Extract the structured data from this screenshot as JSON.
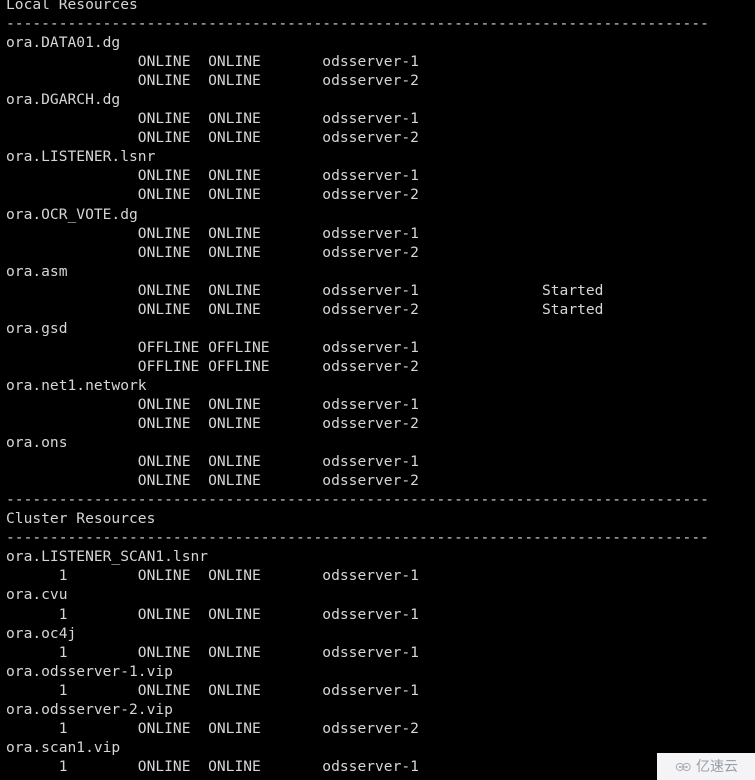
{
  "terminal": {
    "background_color": "#000000",
    "text_color": "#d6d6d6",
    "separator_line": "--------------------------------------------------------------------------------",
    "sections": [
      {
        "title": "Local Resources",
        "resources": [
          {
            "name": "ora.DATA01.dg",
            "instances": [
              {
                "id": "",
                "target": "ONLINE",
                "state": "ONLINE",
                "server": "odsserver-1",
                "details": ""
              },
              {
                "id": "",
                "target": "ONLINE",
                "state": "ONLINE",
                "server": "odsserver-2",
                "details": ""
              }
            ]
          },
          {
            "name": "ora.DGARCH.dg",
            "instances": [
              {
                "id": "",
                "target": "ONLINE",
                "state": "ONLINE",
                "server": "odsserver-1",
                "details": ""
              },
              {
                "id": "",
                "target": "ONLINE",
                "state": "ONLINE",
                "server": "odsserver-2",
                "details": ""
              }
            ]
          },
          {
            "name": "ora.LISTENER.lsnr",
            "instances": [
              {
                "id": "",
                "target": "ONLINE",
                "state": "ONLINE",
                "server": "odsserver-1",
                "details": ""
              },
              {
                "id": "",
                "target": "ONLINE",
                "state": "ONLINE",
                "server": "odsserver-2",
                "details": ""
              }
            ]
          },
          {
            "name": "ora.OCR_VOTE.dg",
            "instances": [
              {
                "id": "",
                "target": "ONLINE",
                "state": "ONLINE",
                "server": "odsserver-1",
                "details": ""
              },
              {
                "id": "",
                "target": "ONLINE",
                "state": "ONLINE",
                "server": "odsserver-2",
                "details": ""
              }
            ]
          },
          {
            "name": "ora.asm",
            "instances": [
              {
                "id": "",
                "target": "ONLINE",
                "state": "ONLINE",
                "server": "odsserver-1",
                "details": "Started"
              },
              {
                "id": "",
                "target": "ONLINE",
                "state": "ONLINE",
                "server": "odsserver-2",
                "details": "Started"
              }
            ]
          },
          {
            "name": "ora.gsd",
            "instances": [
              {
                "id": "",
                "target": "OFFLINE",
                "state": "OFFLINE",
                "server": "odsserver-1",
                "details": ""
              },
              {
                "id": "",
                "target": "OFFLINE",
                "state": "OFFLINE",
                "server": "odsserver-2",
                "details": ""
              }
            ]
          },
          {
            "name": "ora.net1.network",
            "instances": [
              {
                "id": "",
                "target": "ONLINE",
                "state": "ONLINE",
                "server": "odsserver-1",
                "details": ""
              },
              {
                "id": "",
                "target": "ONLINE",
                "state": "ONLINE",
                "server": "odsserver-2",
                "details": ""
              }
            ]
          },
          {
            "name": "ora.ons",
            "instances": [
              {
                "id": "",
                "target": "ONLINE",
                "state": "ONLINE",
                "server": "odsserver-1",
                "details": ""
              },
              {
                "id": "",
                "target": "ONLINE",
                "state": "ONLINE",
                "server": "odsserver-2",
                "details": ""
              }
            ]
          }
        ]
      },
      {
        "title": "Cluster Resources",
        "resources": [
          {
            "name": "ora.LISTENER_SCAN1.lsnr",
            "instances": [
              {
                "id": "1",
                "target": "ONLINE",
                "state": "ONLINE",
                "server": "odsserver-1",
                "details": ""
              }
            ]
          },
          {
            "name": "ora.cvu",
            "instances": [
              {
                "id": "1",
                "target": "ONLINE",
                "state": "ONLINE",
                "server": "odsserver-1",
                "details": ""
              }
            ]
          },
          {
            "name": "ora.oc4j",
            "instances": [
              {
                "id": "1",
                "target": "ONLINE",
                "state": "ONLINE",
                "server": "odsserver-1",
                "details": ""
              }
            ]
          },
          {
            "name": "ora.odsserver-1.vip",
            "instances": [
              {
                "id": "1",
                "target": "ONLINE",
                "state": "ONLINE",
                "server": "odsserver-1",
                "details": ""
              }
            ]
          },
          {
            "name": "ora.odsserver-2.vip",
            "instances": [
              {
                "id": "1",
                "target": "ONLINE",
                "state": "ONLINE",
                "server": "odsserver-2",
                "details": ""
              }
            ]
          },
          {
            "name": "ora.scan1.vip",
            "instances": [
              {
                "id": "1",
                "target": "ONLINE",
                "state": "ONLINE",
                "server": "odsserver-1",
                "details": ""
              }
            ]
          }
        ]
      }
    ],
    "columns": {
      "id_start": 6,
      "target_start": 15,
      "state_start": 23,
      "server_start": 36,
      "details_start": 61
    }
  },
  "watermark": {
    "text": "亿速云",
    "logo_icon": "cloud-icon",
    "panel_color": "#f4f4f6",
    "text_color": "#9aa0a8"
  }
}
